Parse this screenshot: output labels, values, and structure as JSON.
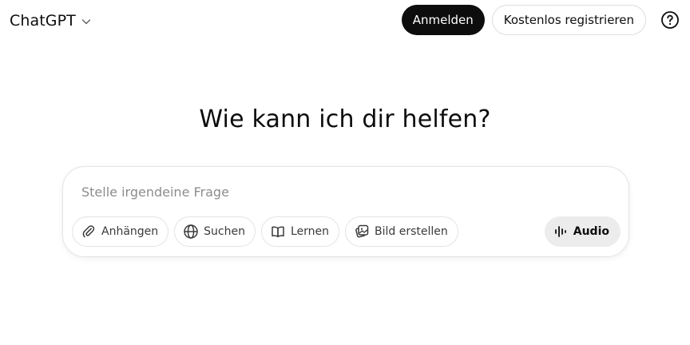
{
  "header": {
    "model_name": "ChatGPT",
    "model_icon": "chevron-down-icon",
    "login_label": "Anmelden",
    "register_label": "Kostenlos registrieren",
    "help_icon": "question-circle-icon"
  },
  "main": {
    "headline": "Wie kann ich dir helfen?"
  },
  "composer": {
    "placeholder": "Stelle irgendeine Frage",
    "tools": [
      {
        "label": "Anhängen",
        "icon": "paperclip-icon"
      },
      {
        "label": "Suchen",
        "icon": "globe-icon"
      },
      {
        "label": "Lernen",
        "icon": "book-icon"
      },
      {
        "label": "Bild erstellen",
        "icon": "image-icon"
      }
    ],
    "audio_label": "Audio",
    "audio_icon": "waveform-icon"
  },
  "colors": {
    "primary_button": "#0d0d0d",
    "audio_button_bg": "#ececec",
    "placeholder_text": "#8c8c8c",
    "border": "#e3e3e3"
  }
}
